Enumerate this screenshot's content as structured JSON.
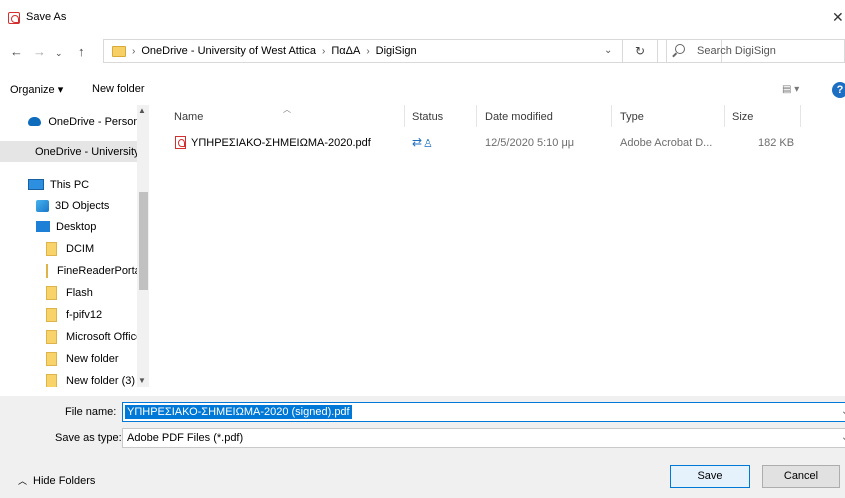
{
  "window": {
    "title": "Save As"
  },
  "address": {
    "crumbs": [
      "OneDrive - University of West Attica",
      "ΠαΔΑ",
      "DigiSign"
    ],
    "search_placeholder": "Search DigiSign"
  },
  "toolbar": {
    "organize_label": "Organize ▾",
    "new_folder_label": "New folder"
  },
  "sidebar": {
    "items": [
      {
        "label": "OneDrive - Personal",
        "icon": "cloud-icon"
      },
      {
        "label": "OneDrive - University of West Attica",
        "icon": "cloud-icon"
      },
      {
        "label": "This PC",
        "icon": "computer-icon"
      },
      {
        "label": "3D Objects",
        "icon": "3d-objects-icon"
      },
      {
        "label": "Desktop",
        "icon": "desktop-icon"
      },
      {
        "label": "DCIM",
        "icon": "folder-icon"
      },
      {
        "label": "FineReaderPortable",
        "icon": "folder-icon"
      },
      {
        "label": "Flash",
        "icon": "folder-icon"
      },
      {
        "label": "f-pifv12",
        "icon": "folder-icon"
      },
      {
        "label": "Microsoft Office",
        "icon": "folder-icon"
      },
      {
        "label": "New folder",
        "icon": "folder-icon"
      },
      {
        "label": "New folder (3)",
        "icon": "folder-icon"
      }
    ]
  },
  "columns": {
    "name": "Name",
    "status": "Status",
    "date": "Date modified",
    "type": "Type",
    "size": "Size"
  },
  "files": [
    {
      "name": "ΥΠΗΡΕΣΙΑΚΟ-ΣΗΜΕΙΩΜΑ-2020.pdf",
      "date": "12/5/2020 5:10 μμ",
      "type": "Adobe Acrobat D...",
      "size": "182 KB"
    }
  ],
  "form": {
    "filename_label": "File name:",
    "filename_value": "ΥΠΗΡΕΣΙΑΚΟ-ΣΗΜΕΙΩΜΑ-2020 (signed).pdf",
    "savetype_label": "Save as type:",
    "savetype_value": "Adobe PDF Files (*.pdf)"
  },
  "footer": {
    "hide_folders_label": "Hide Folders",
    "save_label": "Save",
    "cancel_label": "Cancel"
  },
  "colors": {
    "accent": "#0078d7",
    "pdf_red": "#d32f2f",
    "folder": "#f7d36a"
  }
}
